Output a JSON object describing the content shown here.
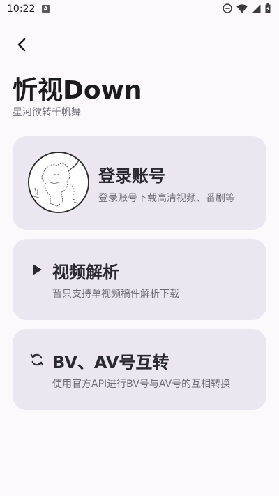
{
  "status_bar": {
    "time": "10:22",
    "notification_badge": "A"
  },
  "header": {
    "title": "忻视Down",
    "subtitle": "星河欲转千帆舞"
  },
  "cards": {
    "login": {
      "title": "登录账号",
      "description": "登录账号下载高清视频、番剧等"
    },
    "parse": {
      "icon": "play-icon",
      "title": "视频解析",
      "description": "暂只支持单视频稿件解析下载"
    },
    "convert": {
      "icon": "refresh-icon",
      "title": "BV、AV号互转",
      "description": "使用官方API进行BV号与AV号的互相转换"
    }
  },
  "colors": {
    "background": "#fdf8fc",
    "card_background": "#ebe6ef",
    "title_text": "#1c1b1f",
    "secondary_text": "#6f6a74"
  }
}
